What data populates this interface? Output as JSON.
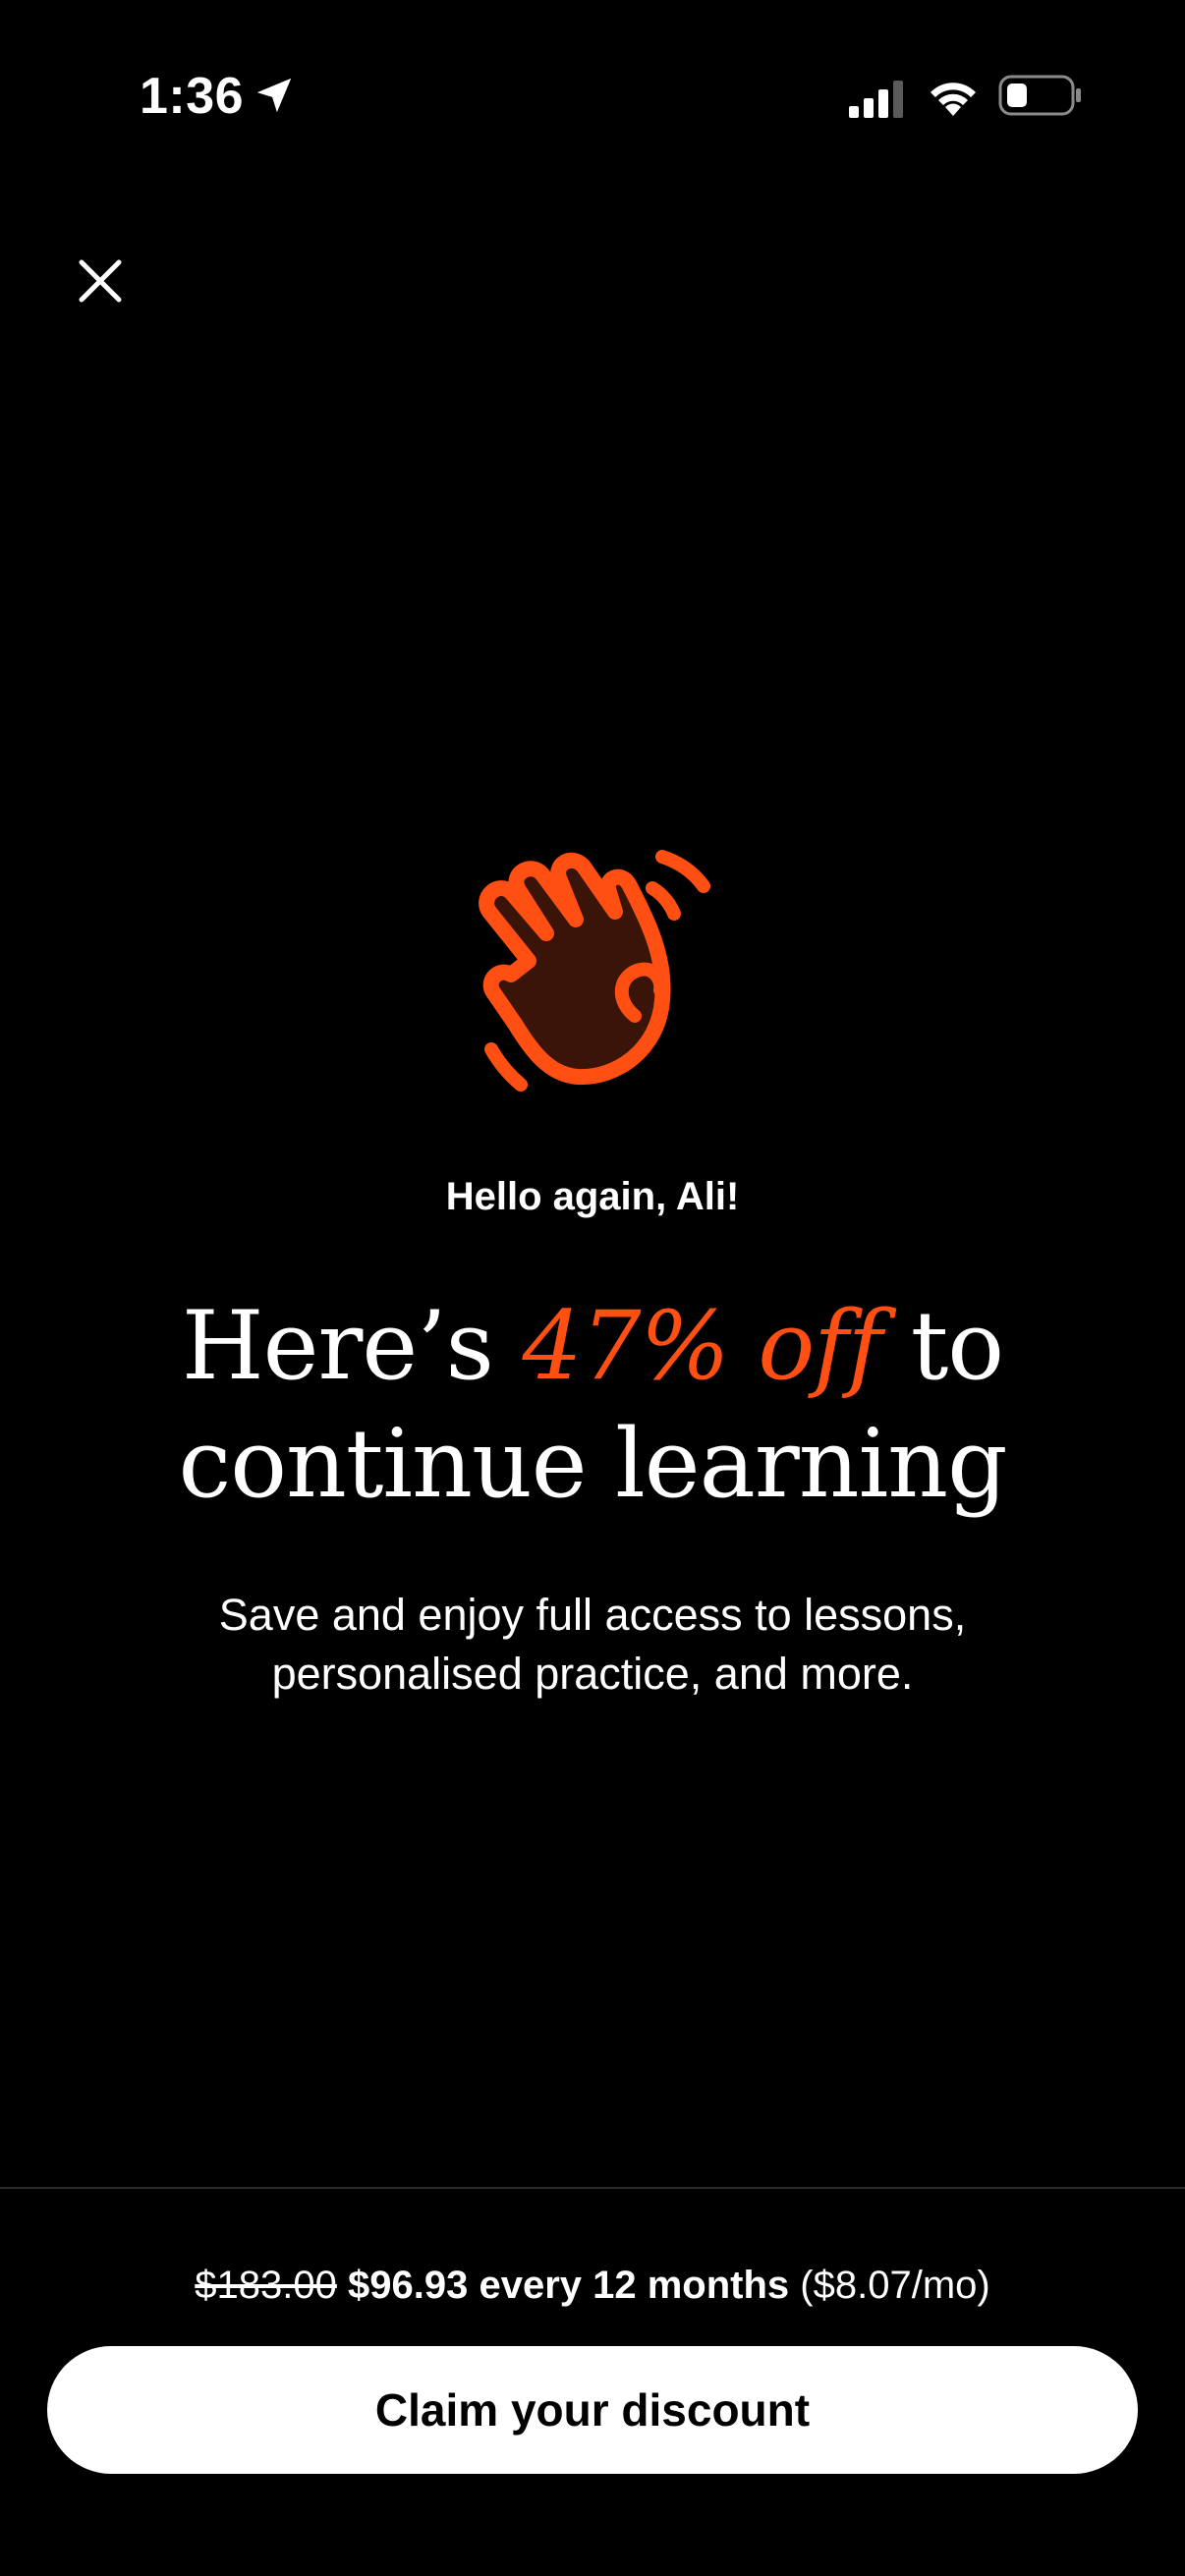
{
  "status_bar": {
    "time": "1:36",
    "icons": [
      "location-arrow-icon",
      "cellular-signal-icon",
      "wifi-icon",
      "battery-icon"
    ]
  },
  "close": {
    "icon": "close-icon"
  },
  "hero": {
    "icon": "waving-hand-icon",
    "greeting": "Hello again, Ali!",
    "headline_before": "Here’s ",
    "headline_accent": "47% off",
    "headline_after_1": " to",
    "headline_line2": "continue learning",
    "subtitle": "Save and enjoy full access to lessons, personalised practice, and more."
  },
  "offer": {
    "old_price": "$183.00",
    "new_price": "$96.93 every 12 months",
    "monthly": "($8.07/mo)",
    "cta_label": "Claim your discount"
  },
  "colors": {
    "background": "#000000",
    "accent": "#ff4f12",
    "accent_dark": "#3a1408",
    "button_bg": "#ffffff",
    "button_text": "#000000",
    "divider": "#2a2a2a"
  }
}
